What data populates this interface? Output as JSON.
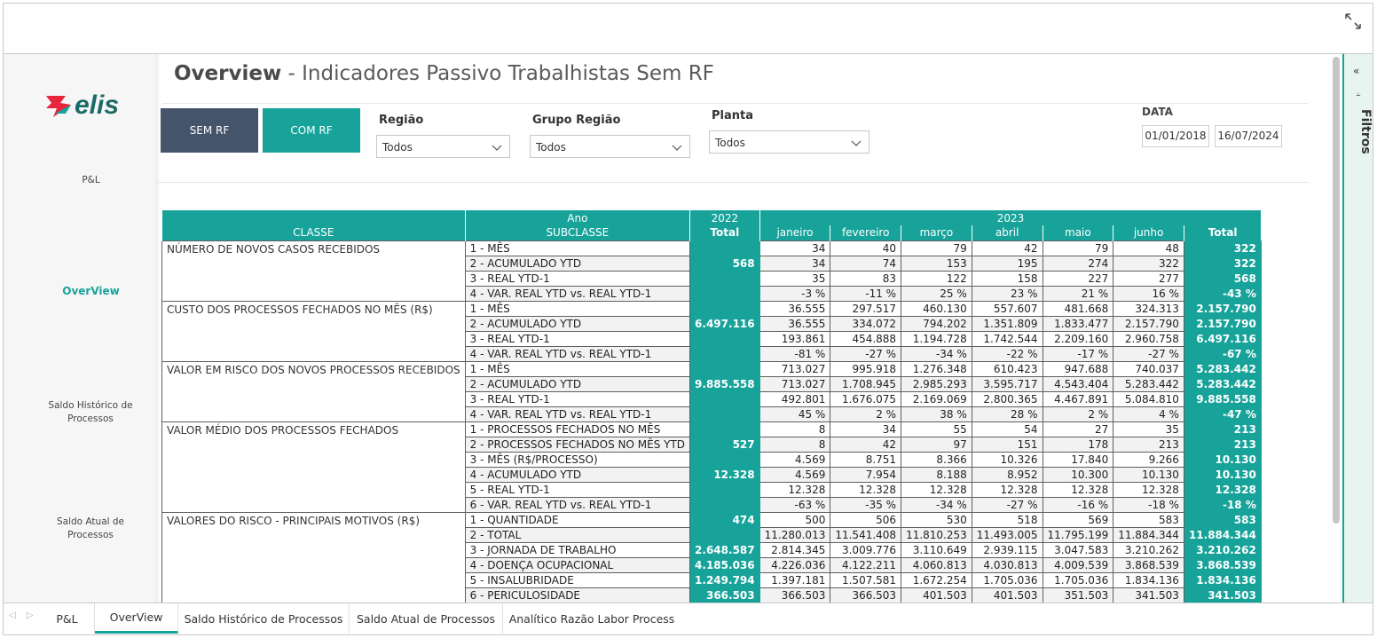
{
  "brand": {
    "logo_text": "elis",
    "accent": "#17a39a",
    "dark": "#44546a"
  },
  "title": {
    "bold": "Overview",
    "rest": " - Indicadores Passivo Trabalhistas Sem RF"
  },
  "nav": {
    "items": [
      "P&L",
      "OverView",
      "Saldo Histórico de Processos",
      "Saldo Atual de Processos"
    ],
    "active": "OverView"
  },
  "buttons": {
    "sem_rf": "SEM RF",
    "com_rf": "COM RF"
  },
  "slicers": {
    "regiao": {
      "label": "Região",
      "value": "Todos"
    },
    "grupo_regiao": {
      "label": "Grupo Região",
      "value": "Todos"
    },
    "planta": {
      "label": "Planta",
      "value": "Todos"
    }
  },
  "date": {
    "label": "DATA",
    "start": "01/01/2018",
    "end": "16/07/2024"
  },
  "filters_pane": {
    "label": "Filtros"
  },
  "matrix": {
    "header1": {
      "ano": "Ano",
      "y2022": "2022",
      "y2023": "2023"
    },
    "header2": {
      "classe": "CLASSE",
      "subclasse": "SUBCLASSE",
      "total2022": "Total",
      "months": [
        "janeiro",
        "fevereiro",
        "março",
        "abril",
        "maio",
        "junho"
      ],
      "total2023": "Total"
    },
    "groups": [
      {
        "classe": "NÚMERO DE NOVOS CASOS RECEBIDOS",
        "total2022": "568",
        "rows": [
          {
            "sub": "1 - MÊS",
            "m": [
              "34",
              "40",
              "79",
              "42",
              "79",
              "48"
            ],
            "t": "322"
          },
          {
            "sub": "2 - ACUMULADO YTD",
            "m": [
              "34",
              "74",
              "153",
              "195",
              "274",
              "322"
            ],
            "t": "322"
          },
          {
            "sub": "3 - REAL YTD-1",
            "m": [
              "35",
              "83",
              "122",
              "158",
              "227",
              "277"
            ],
            "t": "568"
          },
          {
            "sub": "4 - VAR. REAL YTD vs. REAL YTD-1",
            "m": [
              "-3 %",
              "-11 %",
              "25 %",
              "23 %",
              "21 %",
              "16 %"
            ],
            "t": "-43 %"
          }
        ]
      },
      {
        "classe": "CUSTO DOS PROCESSOS FECHADOS NO MÊS (R$)",
        "total2022": "6.497.116",
        "rows": [
          {
            "sub": "1 - MÊS",
            "m": [
              "36.555",
              "297.517",
              "460.130",
              "557.607",
              "481.668",
              "324.313"
            ],
            "t": "2.157.790"
          },
          {
            "sub": "2 - ACUMULADO YTD",
            "m": [
              "36.555",
              "334.072",
              "794.202",
              "1.351.809",
              "1.833.477",
              "2.157.790"
            ],
            "t": "2.157.790"
          },
          {
            "sub": "3 - REAL YTD-1",
            "m": [
              "193.861",
              "454.888",
              "1.194.728",
              "1.742.544",
              "2.209.160",
              "2.960.758"
            ],
            "t": "6.497.116"
          },
          {
            "sub": "4 - VAR. REAL YTD vs. REAL YTD-1",
            "m": [
              "-81 %",
              "-27 %",
              "-34 %",
              "-22 %",
              "-17 %",
              "-27 %"
            ],
            "t": "-67 %"
          }
        ]
      },
      {
        "classe": "VALOR EM RISCO DOS NOVOS PROCESSOS RECEBIDOS",
        "total2022": "9.885.558",
        "rows": [
          {
            "sub": "1 - MÊS",
            "m": [
              "713.027",
              "995.918",
              "1.276.348",
              "610.423",
              "947.688",
              "740.037"
            ],
            "t": "5.283.442"
          },
          {
            "sub": "2 - ACUMULADO YTD",
            "m": [
              "713.027",
              "1.708.945",
              "2.985.293",
              "3.595.717",
              "4.543.404",
              "5.283.442"
            ],
            "t": "5.283.442"
          },
          {
            "sub": "3 - REAL YTD-1",
            "m": [
              "492.801",
              "1.676.075",
              "2.169.069",
              "2.800.365",
              "4.467.891",
              "5.084.810"
            ],
            "t": "9.885.558"
          },
          {
            "sub": "4 - VAR. REAL YTD vs. REAL YTD-1",
            "m": [
              "45 %",
              "2 %",
              "38 %",
              "28 %",
              "2 %",
              "4 %"
            ],
            "t": "-47 %"
          }
        ]
      },
      {
        "classe": "VALOR MÉDIO DOS PROCESSOS FECHADOS",
        "total2022": "527",
        "total2022_b": "12.328",
        "rows": [
          {
            "sub": "1 - PROCESSOS FECHADOS NO MÊS",
            "m": [
              "8",
              "34",
              "55",
              "54",
              "27",
              "35"
            ],
            "t": "213"
          },
          {
            "sub": "2 - PROCESSOS FECHADOS NO MÊS YTD",
            "m": [
              "8",
              "42",
              "97",
              "151",
              "178",
              "213"
            ],
            "t": "213"
          },
          {
            "sub": "3 - MÊS (R$/PROCESSO)",
            "m": [
              "4.569",
              "8.751",
              "8.366",
              "10.326",
              "17.840",
              "9.266"
            ],
            "t": "10.130"
          },
          {
            "sub": "4 - ACUMULADO YTD",
            "m": [
              "4.569",
              "7.954",
              "8.188",
              "8.952",
              "10.300",
              "10.130"
            ],
            "t": "10.130"
          },
          {
            "sub": "5 - REAL YTD-1",
            "m": [
              "12.328",
              "12.328",
              "12.328",
              "12.328",
              "12.328",
              "12.328"
            ],
            "t": "12.328"
          },
          {
            "sub": "6 - VAR. REAL YTD vs. REAL YTD-1",
            "m": [
              "-63 %",
              "-35 %",
              "-34 %",
              "-27 %",
              "-16 %",
              "-18 %"
            ],
            "t": "-18 %"
          }
        ]
      },
      {
        "classe": "VALORES DO RISCO - PRINCIPAIS MOTIVOS (R$)",
        "rows": [
          {
            "sub": "1 - QUANTIDADE",
            "y22": "474",
            "m": [
              "500",
              "506",
              "530",
              "518",
              "569",
              "583"
            ],
            "t": "583"
          },
          {
            "sub": "2 - TOTAL",
            "y22": "",
            "m": [
              "11.280.013",
              "11.541.408",
              "11.810.253",
              "11.493.005",
              "11.795.199",
              "11.884.344"
            ],
            "t": "11.884.344"
          },
          {
            "sub": "3 - JORNADA DE TRABALHO",
            "y22": "2.648.587",
            "m": [
              "2.814.345",
              "3.009.776",
              "3.110.649",
              "2.939.115",
              "3.047.583",
              "3.210.262"
            ],
            "t": "3.210.262"
          },
          {
            "sub": "4 - DOENÇA OCUPACIONAL",
            "y22": "4.185.036",
            "m": [
              "4.226.036",
              "4.122.211",
              "4.060.813",
              "4.030.813",
              "4.009.539",
              "3.868.539"
            ],
            "t": "3.868.539"
          },
          {
            "sub": "5 - INSALUBRIDADE",
            "y22": "1.249.794",
            "m": [
              "1.397.181",
              "1.507.581",
              "1.672.254",
              "1.705.036",
              "1.705.036",
              "1.834.136"
            ],
            "t": "1.834.136"
          },
          {
            "sub": "6 - PERICULOSIDADE",
            "y22": "366.503",
            "m": [
              "366.503",
              "366.503",
              "401.503",
              "401.503",
              "351.503",
              "341.503"
            ],
            "t": "341.503"
          }
        ]
      }
    ]
  },
  "page_tabs": [
    "P&L",
    "OverView",
    "Saldo Histórico de Processos",
    "Saldo Atual de Processos",
    "Analítico Razão Labor Process"
  ],
  "active_tab": "OverView"
}
